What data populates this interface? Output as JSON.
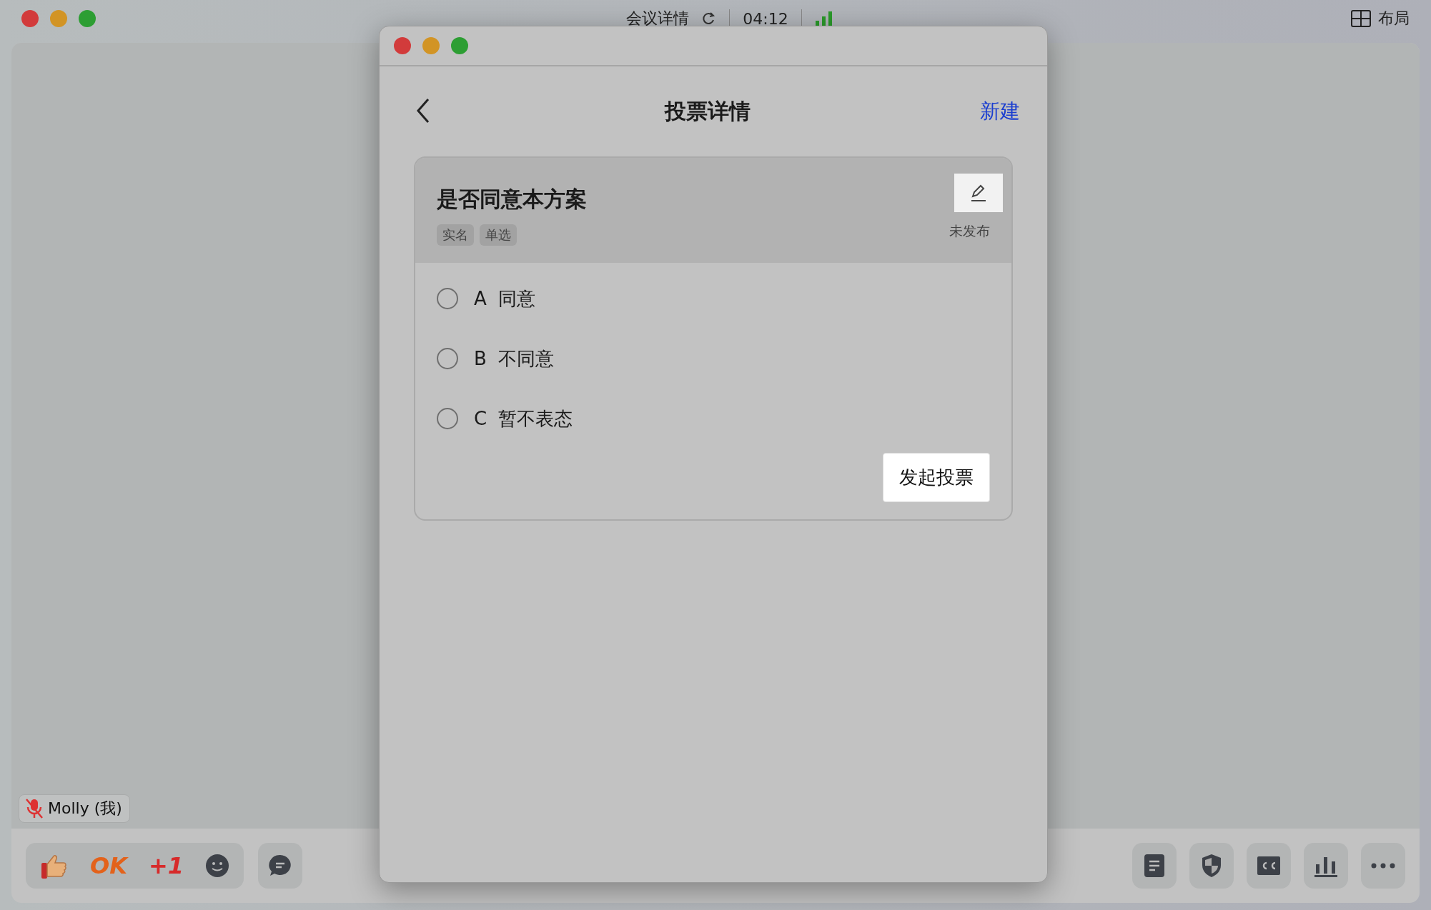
{
  "top_bar": {
    "meeting_title": "会议详情",
    "timer": "04:12",
    "layout_button": "布局"
  },
  "participant": {
    "name": "Molly (我)",
    "muted": true
  },
  "reactions": [
    "OK",
    "+1"
  ],
  "modal": {
    "title": "投票详情",
    "new_button": "新建",
    "poll": {
      "question": "是否同意本方案",
      "tags": [
        "实名",
        "单选"
      ],
      "status": "未发布",
      "options": [
        {
          "letter": "A",
          "text": "同意",
          "selected": false
        },
        {
          "letter": "B",
          "text": "不同意",
          "selected": false
        },
        {
          "letter": "C",
          "text": "暂不表态",
          "selected": false
        }
      ],
      "submit": "发起投票"
    }
  }
}
